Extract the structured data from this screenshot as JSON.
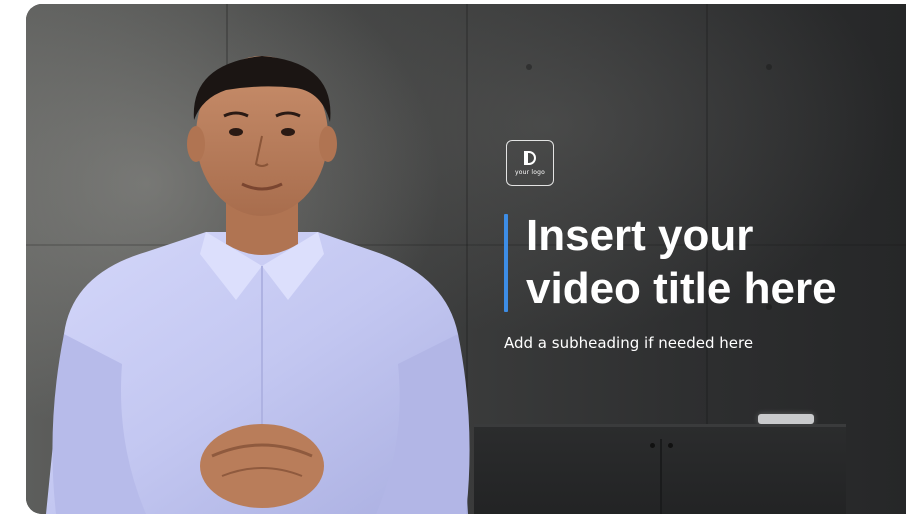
{
  "slide": {
    "logo_text": "your logo",
    "title_line1": "Insert your",
    "title_line2": "video title here",
    "subheading": "Add a subheading if needed here"
  },
  "colors": {
    "accent": "#3d8de6",
    "title_text": "#ffffff",
    "wall_dark": "#262728",
    "shirt": "#c7cbf4"
  },
  "icons": [
    "logo-icon"
  ]
}
